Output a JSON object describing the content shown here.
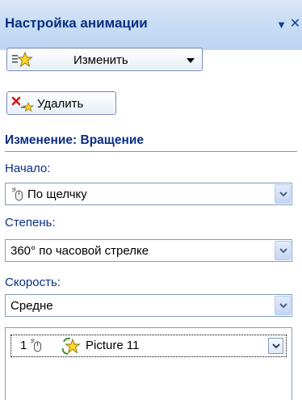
{
  "pane": {
    "title": "Настройка анимации",
    "menu_icon": "triangle-down-icon",
    "close_icon": "close-icon"
  },
  "toolbar": {
    "change_label": "Изменить",
    "delete_label": "Удалить"
  },
  "effect": {
    "heading": "Изменение: Вращение",
    "start_label": "Начало:",
    "start_value": "По щелчку",
    "degree_label": "Степень:",
    "degree_value": "360° по часовой стрелке",
    "speed_label": "Скорость:",
    "speed_value": "Средне"
  },
  "animation_list": [
    {
      "order": "1",
      "trigger": "mouse-click-icon",
      "effect_icon": "spin-star-icon",
      "name": "Picture 11"
    }
  ],
  "colors": {
    "title_text": "#0a2f80",
    "title_bar": "#c6dbf4",
    "border": "#7f9db9"
  }
}
